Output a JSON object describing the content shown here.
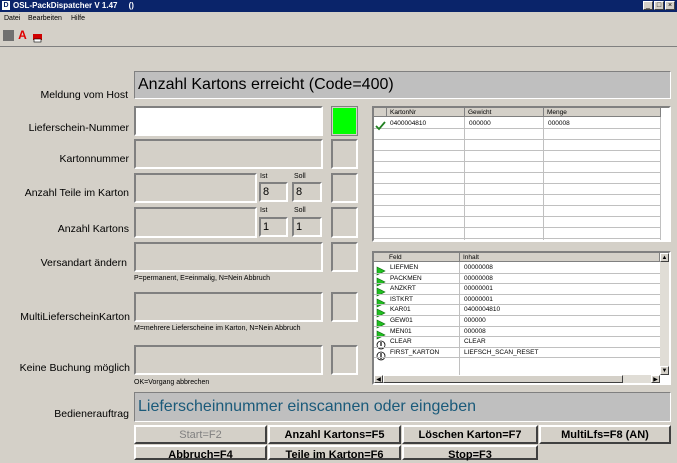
{
  "window": {
    "title": "OSL-PackDispatcher V 1.47     ()",
    "icon_letter": "D"
  },
  "menu": [
    "Datei",
    "Bearbeiten",
    "Hilfe"
  ],
  "labels": {
    "meldung": "Meldung vom Host",
    "lieferschein": "Lieferschein-Nummer",
    "kartonnummer": "Kartonnummer",
    "anzahl_teile": "Anzahl Teile im Karton",
    "anzahl_kartons": "Anzahl Kartons",
    "versandart": "Versandart ändern",
    "multi": "MultiLieferscheinKarton",
    "keine_buchung": "Keine Buchung möglich",
    "bediener": "Bedienerauftrag"
  },
  "host_message": "Anzahl Kartons erreicht (Code=400)",
  "operator_task": "Lieferscheinnummer einscannen oder eingeben",
  "lieferschein_value": "",
  "teile": {
    "ist_label": "Ist",
    "soll_label": "Soll",
    "ist": "8",
    "soll": "8"
  },
  "kartons": {
    "ist_label": "Ist",
    "soll_label": "Soll",
    "ist": "1",
    "soll": "1"
  },
  "hints": {
    "versandart": "P=permanent, E=einmalig, N=Nein Abbruch",
    "multi": "M=mehrere Lieferscheine im Karton, N=Nein Abbruch",
    "keine_buchung": "OK=Vorgang abbrechen"
  },
  "status_color": "#00ff00",
  "karton_table": {
    "headers": [
      "KartonNr",
      "Gewicht",
      "Menge"
    ],
    "rows": [
      {
        "check": true,
        "kartonnr": "0400004810",
        "gewicht": "000000",
        "menge": "000008"
      }
    ]
  },
  "field_table": {
    "headers": [
      "Feld",
      "Inhalt"
    ],
    "rows": [
      {
        "icon": "green-arrow",
        "feld": "LIEFMEN",
        "inhalt": "00000008"
      },
      {
        "icon": "green-arrow",
        "feld": "PACKMEN",
        "inhalt": "00000008"
      },
      {
        "icon": "green-arrow",
        "feld": "ANZKRT",
        "inhalt": "00000001"
      },
      {
        "icon": "green-arrow",
        "feld": "ISTKRT",
        "inhalt": "00000001"
      },
      {
        "icon": "green-arrow",
        "feld": "KAR01",
        "inhalt": "0400004810"
      },
      {
        "icon": "green-arrow",
        "feld": "GEW01",
        "inhalt": "000000"
      },
      {
        "icon": "green-arrow",
        "feld": "MEN01",
        "inhalt": "000008"
      },
      {
        "icon": "info",
        "feld": "CLEAR",
        "inhalt": "CLEAR"
      },
      {
        "icon": "info",
        "feld": "FIRST_KARTON",
        "inhalt": "LIEFSCH_SCAN_RESET"
      }
    ]
  },
  "buttons": {
    "start": "Start=F2",
    "anzahl_kartons": "Anzahl Kartons=F5",
    "loeschen": "Löschen Karton=F7",
    "multilfs": "MultiLfs=F8 (AN)",
    "abbruch": "Abbruch=F4",
    "teile": "Teile im Karton=F6",
    "stop": "Stop=F3"
  }
}
